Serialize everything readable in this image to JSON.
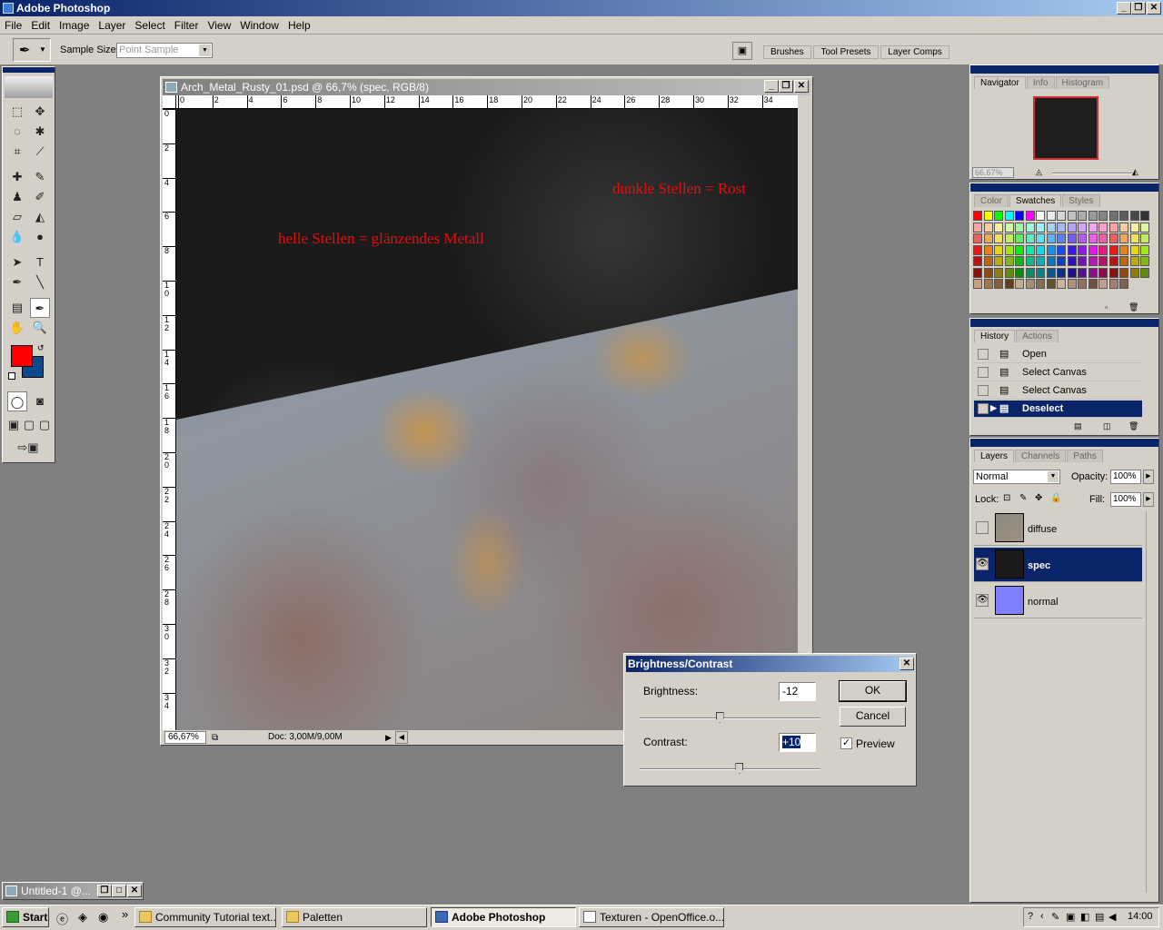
{
  "app_title": "Adobe Photoshop",
  "menu": [
    "File",
    "Edit",
    "Image",
    "Layer",
    "Select",
    "Filter",
    "View",
    "Window",
    "Help"
  ],
  "options": {
    "sample_size_label": "Sample Size:",
    "sample_size_value": "Point Sample",
    "tabs": [
      "Brushes",
      "Tool Presets",
      "Layer Comps"
    ]
  },
  "document": {
    "title": "Arch_Metal_Rusty_01.psd @ 66,7% (spec, RGB/8)",
    "ruler_h": [
      "0",
      "2",
      "4",
      "6",
      "8",
      "10",
      "12",
      "14",
      "16",
      "18",
      "20",
      "22",
      "24",
      "26",
      "28",
      "30",
      "32",
      "34"
    ],
    "ruler_v": [
      "0",
      "2",
      "4",
      "6",
      "8",
      "10",
      "12",
      "14",
      "16",
      "18",
      "20",
      "22",
      "24",
      "26",
      "28",
      "30",
      "32",
      "34"
    ],
    "annotation_light": "helle Stellen = glänzendes Metall",
    "annotation_dark": "dunkle Stellen = Rost",
    "zoom": "66,67%",
    "doc_size": "Doc: 3,00M/9,00M"
  },
  "colors": {
    "foreground": "#ff0000",
    "background": "#0a4a8a",
    "accent": "#0a246a"
  },
  "navigator": {
    "tabs": [
      "Navigator",
      "Info",
      "Histogram"
    ],
    "zoom": "66.67%"
  },
  "swatches": {
    "tabs": [
      "Color",
      "Swatches",
      "Styles"
    ]
  },
  "history": {
    "tabs": [
      "History",
      "Actions"
    ],
    "items": [
      "Open",
      "Select Canvas",
      "Select Canvas",
      "Deselect"
    ],
    "selected": 3
  },
  "layers": {
    "tabs": [
      "Layers",
      "Channels",
      "Paths"
    ],
    "blend_mode": "Normal",
    "opacity_label": "Opacity:",
    "opacity": "100%",
    "lock_label": "Lock:",
    "fill_label": "Fill:",
    "fill": "100%",
    "items": [
      {
        "name": "diffuse",
        "visible": false,
        "selected": false
      },
      {
        "name": "spec",
        "visible": true,
        "selected": true
      },
      {
        "name": "normal",
        "visible": true,
        "selected": false
      }
    ]
  },
  "dialog": {
    "title": "Brightness/Contrast",
    "brightness_label": "Brightness:",
    "brightness": "-12",
    "brightness_level": 0.44,
    "contrast_label": "Contrast:",
    "contrast": "+10",
    "contrast_level": 0.55,
    "ok": "OK",
    "cancel": "Cancel",
    "preview_label": "Preview",
    "preview_checked": true
  },
  "minimized_doc": "Untitled-1 @...",
  "taskbar": {
    "start": "Start",
    "tasks": [
      "Community Tutorial text...",
      "Paletten",
      "Adobe Photoshop",
      "Texturen - OpenOffice.o..."
    ],
    "active": 2,
    "clock": "14:00"
  }
}
